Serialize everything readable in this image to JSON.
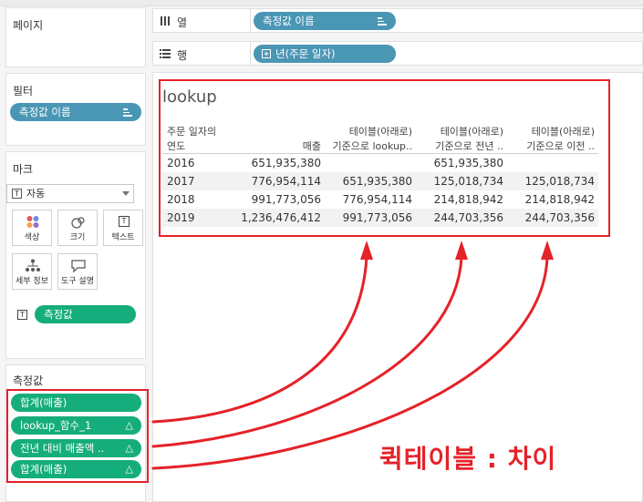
{
  "pages": {
    "title": "페이지"
  },
  "filters": {
    "title": "필터",
    "pill_label": "측정값 이름"
  },
  "marks": {
    "title": "마크",
    "type_value": "자동",
    "buttons": [
      {
        "label": "색상",
        "icon": "color-dots-icon"
      },
      {
        "label": "크기",
        "icon": "size-circles-icon"
      },
      {
        "label": "텍스트",
        "icon": "text-t-icon"
      },
      {
        "label": "세부 정보",
        "icon": "detail-tree-icon"
      },
      {
        "label": "도구 설명",
        "icon": "tooltip-bubble-icon"
      }
    ],
    "text_pill_label": "측정값"
  },
  "measure_values": {
    "title": "측정값",
    "items": [
      {
        "label": "합계(매출)",
        "delta": ""
      },
      {
        "label": "lookup_함수_1",
        "delta": "△"
      },
      {
        "label": "전년 대비 매출액 ..",
        "delta": "△"
      },
      {
        "label": "합계(매출)",
        "delta": "△"
      }
    ]
  },
  "shelves": {
    "columns": {
      "label": "열",
      "pill_label": "측정값 이름"
    },
    "rows": {
      "label": "행",
      "pill_label": "년(주문 일자)"
    }
  },
  "view": {
    "title": "lookup",
    "row_header": [
      "주문 일자의",
      "연도"
    ],
    "columns": [
      {
        "line1": "",
        "line2": "매출"
      },
      {
        "line1": "테이블(아래로)",
        "line2": "기준으로 lookup.."
      },
      {
        "line1": "테이블(아래로)",
        "line2": "기준으로 전년 .."
      },
      {
        "line1": "테이블(아래로)",
        "line2": "기준으로 이전 .."
      }
    ],
    "rows": [
      {
        "year": "2016",
        "values": [
          "651,935,380",
          "",
          "651,935,380",
          ""
        ]
      },
      {
        "year": "2017",
        "values": [
          "776,954,114",
          "651,935,380",
          "125,018,734",
          "125,018,734"
        ]
      },
      {
        "year": "2018",
        "values": [
          "991,773,056",
          "776,954,114",
          "214,818,942",
          "214,818,942"
        ]
      },
      {
        "year": "2019",
        "values": [
          "1,236,476,412",
          "991,773,056",
          "244,703,356",
          "244,703,356"
        ]
      }
    ]
  },
  "annotation": "퀵테이블 : 차이",
  "colors": {
    "measure_pill": "#15ad7b",
    "dimension_pill": "#4a96b5",
    "highlight": "#e52228"
  }
}
